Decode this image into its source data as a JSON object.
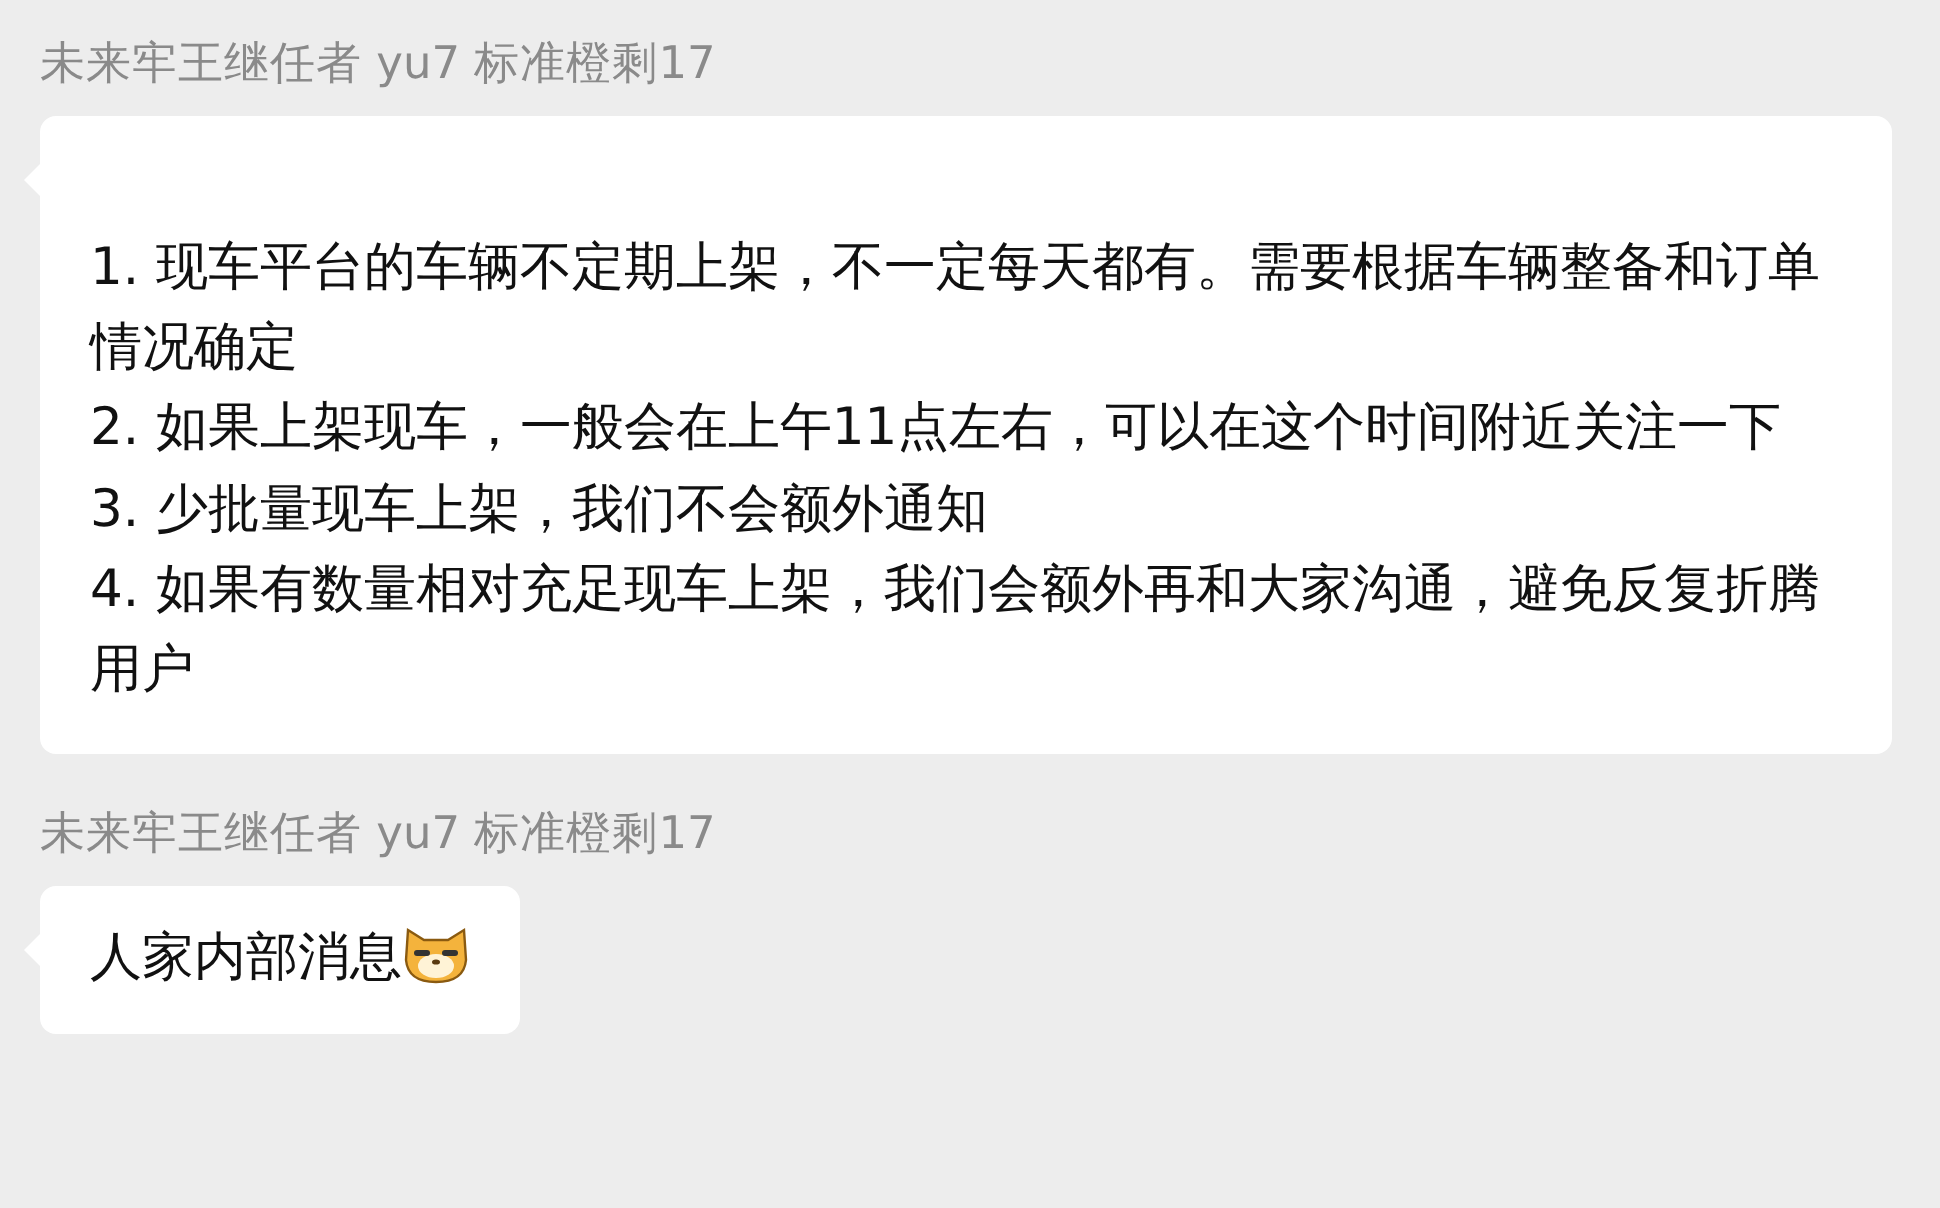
{
  "messages": [
    {
      "sender": "未来牢王继任者 yu7 标准橙剩17",
      "paragraphs": [
        "1. 现车平台的车辆不定期上架，不一定每天都有。需要根据车辆整备和订单情况确定",
        "2. 如果上架现车，一般会在上午11点左右，可以在这个时间附近关注一下",
        "3. 少批量现车上架，我们不会额外通知",
        "4. 如果有数量相对充足现车上架，我们会额外再和大家沟通，避免反复折腾用户"
      ],
      "has_emoji": false
    },
    {
      "sender": "未来牢王继任者 yu7 标准橙剩17",
      "paragraphs": [
        "人家内部消息"
      ],
      "has_emoji": true
    }
  ]
}
